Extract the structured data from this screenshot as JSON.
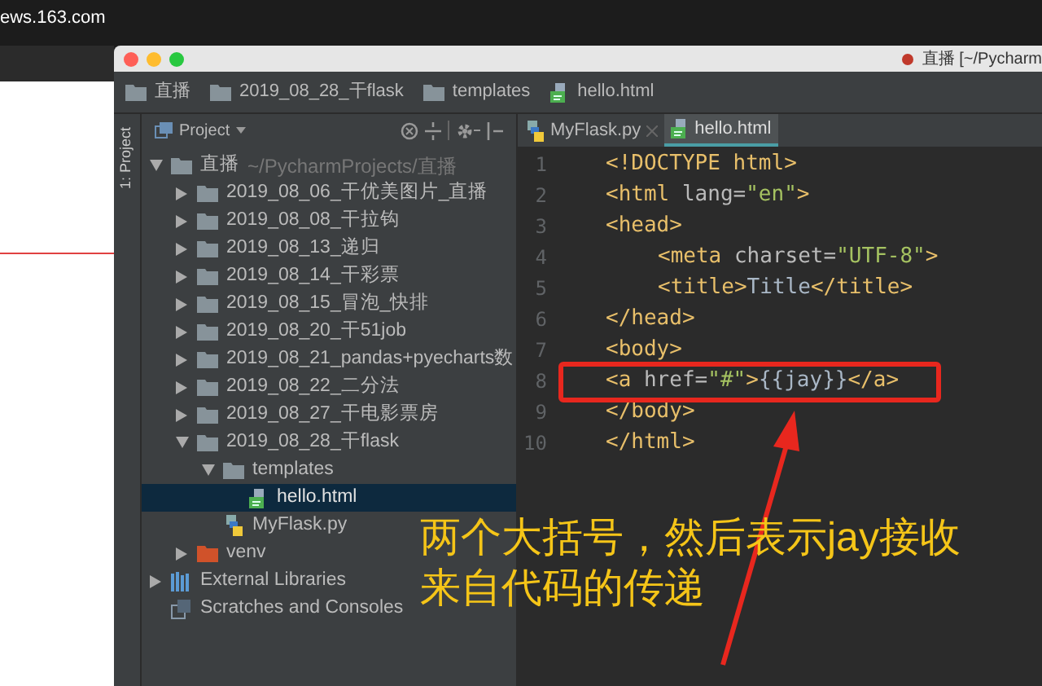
{
  "browser": {
    "address": "ews.163.com"
  },
  "window": {
    "title": "直播 [~/Pycharm"
  },
  "breadcrumbs": [
    {
      "label": "直播",
      "kind": "folder"
    },
    {
      "label": "2019_08_28_干flask",
      "kind": "folder"
    },
    {
      "label": "templates",
      "kind": "folder"
    },
    {
      "label": "hello.html",
      "kind": "html"
    }
  ],
  "tool_strip": {
    "label": "1: Project"
  },
  "project_panel": {
    "title": "Project",
    "tree": [
      {
        "label": "直播",
        "path": "~/PycharmProjects/直播",
        "kind": "folder",
        "expanded": true,
        "selected": false,
        "children": [
          {
            "label": "2019_08_06_干优美图片_直播",
            "kind": "folder",
            "expanded": false,
            "selected": false
          },
          {
            "label": "2019_08_08_干拉钩",
            "kind": "folder",
            "expanded": false,
            "selected": false
          },
          {
            "label": "2019_08_13_递归",
            "kind": "folder",
            "expanded": false,
            "selected": false
          },
          {
            "label": "2019_08_14_干彩票",
            "kind": "folder",
            "expanded": false,
            "selected": false
          },
          {
            "label": "2019_08_15_冒泡_快排",
            "kind": "folder",
            "expanded": false,
            "selected": false
          },
          {
            "label": "2019_08_20_干51job",
            "kind": "folder",
            "expanded": false,
            "selected": false
          },
          {
            "label": "2019_08_21_pandas+pyecharts数",
            "kind": "folder",
            "expanded": false,
            "selected": false
          },
          {
            "label": "2019_08_22_二分法",
            "kind": "folder",
            "expanded": false,
            "selected": false
          },
          {
            "label": "2019_08_27_干电影票房",
            "kind": "folder",
            "expanded": false,
            "selected": false
          },
          {
            "label": "2019_08_28_干flask",
            "kind": "folder",
            "expanded": true,
            "selected": false,
            "children": [
              {
                "label": "templates",
                "kind": "folder",
                "expanded": true,
                "selected": false,
                "children": [
                  {
                    "label": "hello.html",
                    "kind": "html",
                    "selected": true
                  }
                ]
              },
              {
                "label": "MyFlask.py",
                "kind": "python",
                "selected": false
              }
            ]
          },
          {
            "label": "venv",
            "kind": "venv",
            "expanded": false,
            "selected": false
          }
        ]
      },
      {
        "label": "External Libraries",
        "kind": "library",
        "expanded": false,
        "selected": false
      },
      {
        "label": "Scratches and Consoles",
        "kind": "scratches",
        "selected": false
      }
    ]
  },
  "editor": {
    "tabs": [
      {
        "label": "MyFlask.py",
        "kind": "python",
        "selected": false
      },
      {
        "label": "hello.html",
        "kind": "html",
        "selected": true
      }
    ],
    "lines": [
      {
        "number": "1",
        "indent": false,
        "tokens": [
          {
            "kind": "tag",
            "text": "<!DOCTYPE html>"
          }
        ]
      },
      {
        "number": "2",
        "indent": false,
        "tokens": [
          {
            "kind": "tag",
            "text": "<html"
          },
          {
            "kind": "attr",
            "text": " lang="
          },
          {
            "kind": "value",
            "text": "\"en\""
          },
          {
            "kind": "tag",
            "text": ">"
          }
        ]
      },
      {
        "number": "3",
        "indent": false,
        "tokens": [
          {
            "kind": "tag",
            "text": "<head>"
          }
        ]
      },
      {
        "number": "4",
        "indent": true,
        "tokens": [
          {
            "kind": "tag",
            "text": "<meta"
          },
          {
            "kind": "attr",
            "text": " charset="
          },
          {
            "kind": "value",
            "text": "\"UTF-8\""
          },
          {
            "kind": "tag",
            "text": ">"
          }
        ]
      },
      {
        "number": "5",
        "indent": true,
        "tokens": [
          {
            "kind": "tag",
            "text": "<title>"
          },
          {
            "kind": "text",
            "text": "Title"
          },
          {
            "kind": "tag",
            "text": "</title>"
          }
        ]
      },
      {
        "number": "6",
        "indent": false,
        "tokens": [
          {
            "kind": "tag",
            "text": "</head>"
          }
        ]
      },
      {
        "number": "7",
        "indent": false,
        "tokens": [
          {
            "kind": "tag",
            "text": "<body>"
          }
        ]
      },
      {
        "number": "8",
        "indent": false,
        "tokens": [
          {
            "kind": "tag",
            "text": "<a"
          },
          {
            "kind": "attr",
            "text": " href="
          },
          {
            "kind": "value",
            "text": "\"#\""
          },
          {
            "kind": "tag",
            "text": ">"
          },
          {
            "kind": "text",
            "text": "{{jay}}"
          },
          {
            "kind": "tag",
            "text": "</a>"
          }
        ]
      },
      {
        "number": "9",
        "indent": false,
        "tokens": [
          {
            "kind": "tag",
            "text": "</body>"
          }
        ]
      },
      {
        "number": "10",
        "indent": false,
        "tokens": [
          {
            "kind": "tag",
            "text": "</html>"
          }
        ]
      }
    ]
  },
  "annotation": {
    "lines": [
      "两个大括号，然后表示jay接收",
      "来自代码的传递"
    ]
  }
}
